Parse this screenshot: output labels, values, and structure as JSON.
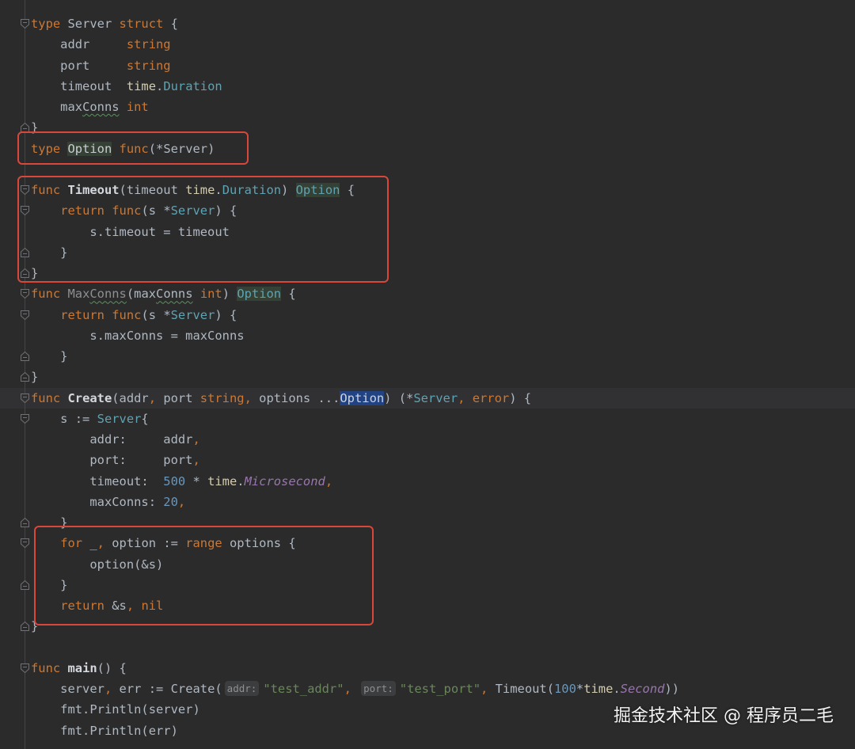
{
  "editor": {
    "lines": [
      {
        "fold_icon": "fold-start-icon",
        "tokens": [
          {
            "t": "type",
            "c": "#cc7832"
          },
          {
            "t": " Server ",
            "c": "#b0b8c1"
          },
          {
            "t": "struct",
            "c": "#cc7832"
          },
          {
            "t": " {",
            "c": "#b0b8c1"
          }
        ]
      },
      {
        "tokens": [
          {
            "t": "    addr     ",
            "c": "#b0b8c1"
          },
          {
            "t": "string",
            "c": "#cc7832"
          }
        ]
      },
      {
        "tokens": [
          {
            "t": "    port     ",
            "c": "#b0b8c1"
          },
          {
            "t": "string",
            "c": "#cc7832"
          }
        ]
      },
      {
        "tokens": [
          {
            "t": "    timeout  ",
            "c": "#b0b8c1"
          },
          {
            "t": "time",
            "c": "#d3ccae"
          },
          {
            "t": ".",
            "c": "#b0b8c1"
          },
          {
            "t": "Duration",
            "c": "#5fa3b3"
          }
        ]
      },
      {
        "tokens": [
          {
            "t": "    max",
            "c": "#b0b8c1"
          },
          {
            "t": "Conns",
            "c": "#b0b8c1",
            "wavy": true
          },
          {
            "t": " ",
            "c": "#b0b8c1"
          },
          {
            "t": "int",
            "c": "#cc7832"
          }
        ]
      },
      {
        "fold_icon": "fold-end-icon",
        "tokens": [
          {
            "t": "}",
            "c": "#b0b8c1"
          }
        ]
      },
      {
        "tokens": [
          {
            "t": "type",
            "c": "#cc7832"
          },
          {
            "t": " ",
            "c": "#b0b8c1"
          },
          {
            "t": "Option",
            "c": "#c9ccd1",
            "bg": "#344134"
          },
          {
            "t": " ",
            "c": "#b0b8c1"
          },
          {
            "t": "func",
            "c": "#cc7832"
          },
          {
            "t": "(*Server)",
            "c": "#b0b8c1"
          }
        ]
      },
      {
        "tokens": []
      },
      {
        "fold_icon": "fold-start-icon",
        "tokens": [
          {
            "t": "func",
            "c": "#cc7832"
          },
          {
            "t": " ",
            "c": "#b0b8c1"
          },
          {
            "t": "Timeout",
            "c": "#d4d7dc",
            "bold": true
          },
          {
            "t": "(timeout ",
            "c": "#b0b8c1"
          },
          {
            "t": "time",
            "c": "#d3ccae"
          },
          {
            "t": ".",
            "c": "#b0b8c1"
          },
          {
            "t": "Duration",
            "c": "#5fa3b3"
          },
          {
            "t": ") ",
            "c": "#b0b8c1"
          },
          {
            "t": "Option",
            "c": "#5fa3b3",
            "bg": "#344134"
          },
          {
            "t": " {",
            "c": "#b0b8c1"
          }
        ]
      },
      {
        "fold_icon": "fold-start-icon",
        "tokens": [
          {
            "t": "    ",
            "c": "#b0b8c1"
          },
          {
            "t": "return",
            "c": "#cc7832"
          },
          {
            "t": " ",
            "c": "#b0b8c1"
          },
          {
            "t": "func",
            "c": "#cc7832"
          },
          {
            "t": "(s *",
            "c": "#b0b8c1"
          },
          {
            "t": "Server",
            "c": "#5fa3b3"
          },
          {
            "t": ") {",
            "c": "#b0b8c1"
          }
        ]
      },
      {
        "tokens": [
          {
            "t": "        s.timeout = timeout",
            "c": "#b0b8c1"
          }
        ]
      },
      {
        "fold_icon": "fold-end-icon",
        "tokens": [
          {
            "t": "    }",
            "c": "#b0b8c1"
          }
        ]
      },
      {
        "fold_icon": "fold-end-icon",
        "tokens": [
          {
            "t": "}",
            "c": "#b0b8c1"
          }
        ]
      },
      {
        "fold_icon": "fold-start-icon",
        "tokens": [
          {
            "t": "func",
            "c": "#cc7832"
          },
          {
            "t": " ",
            "c": "#b0b8c1"
          },
          {
            "t": "Max",
            "c": "#8e8f91"
          },
          {
            "t": "Conns",
            "c": "#8e8f91",
            "wavy": true
          },
          {
            "t": "(max",
            "c": "#b0b8c1"
          },
          {
            "t": "Conns",
            "c": "#b0b8c1",
            "wavy": true
          },
          {
            "t": " ",
            "c": "#b0b8c1"
          },
          {
            "t": "int",
            "c": "#cc7832"
          },
          {
            "t": ") ",
            "c": "#b0b8c1"
          },
          {
            "t": "Option",
            "c": "#5fa3b3",
            "bg": "#344134"
          },
          {
            "t": " {",
            "c": "#b0b8c1"
          }
        ]
      },
      {
        "fold_icon": "fold-start-icon",
        "tokens": [
          {
            "t": "    ",
            "c": "#b0b8c1"
          },
          {
            "t": "return",
            "c": "#cc7832"
          },
          {
            "t": " ",
            "c": "#b0b8c1"
          },
          {
            "t": "func",
            "c": "#cc7832"
          },
          {
            "t": "(s *",
            "c": "#b0b8c1"
          },
          {
            "t": "Server",
            "c": "#5fa3b3"
          },
          {
            "t": ") {",
            "c": "#b0b8c1"
          }
        ]
      },
      {
        "tokens": [
          {
            "t": "        s.maxConns = maxConns",
            "c": "#b0b8c1"
          }
        ]
      },
      {
        "fold_icon": "fold-end-icon",
        "tokens": [
          {
            "t": "    }",
            "c": "#b0b8c1"
          }
        ]
      },
      {
        "fold_icon": "fold-end-icon",
        "tokens": [
          {
            "t": "}",
            "c": "#b0b8c1"
          }
        ]
      },
      {
        "fold_icon": "fold-start-icon",
        "current": true,
        "tokens": [
          {
            "t": "func",
            "c": "#cc7832"
          },
          {
            "t": " ",
            "c": "#b0b8c1"
          },
          {
            "t": "Create",
            "c": "#d4d7dc",
            "bold": true
          },
          {
            "t": "(addr",
            "c": "#b0b8c1"
          },
          {
            "t": ",",
            "c": "#cc7832"
          },
          {
            "t": " port ",
            "c": "#b0b8c1"
          },
          {
            "t": "string",
            "c": "#cc7832"
          },
          {
            "t": ",",
            "c": "#cc7832"
          },
          {
            "t": " options ...",
            "c": "#b0b8c1"
          },
          {
            "t": "Option",
            "c": "#c9d3e3",
            "bg": "#214283"
          },
          {
            "t": ") (*",
            "c": "#b0b8c1"
          },
          {
            "t": "Server",
            "c": "#5fa3b3"
          },
          {
            "t": ",",
            "c": "#cc7832"
          },
          {
            "t": " ",
            "c": "#b0b8c1"
          },
          {
            "t": "error",
            "c": "#cc7832"
          },
          {
            "t": ") {",
            "c": "#b0b8c1"
          }
        ]
      },
      {
        "fold_icon": "fold-start-icon",
        "tokens": [
          {
            "t": "    s := ",
            "c": "#b0b8c1"
          },
          {
            "t": "Server",
            "c": "#5fa3b3"
          },
          {
            "t": "{",
            "c": "#b0b8c1"
          }
        ]
      },
      {
        "tokens": [
          {
            "t": "        addr:     addr",
            "c": "#b0b8c1"
          },
          {
            "t": ",",
            "c": "#cc7832"
          }
        ]
      },
      {
        "tokens": [
          {
            "t": "        port:     port",
            "c": "#b0b8c1"
          },
          {
            "t": ",",
            "c": "#cc7832"
          }
        ]
      },
      {
        "tokens": [
          {
            "t": "        timeout:  ",
            "c": "#b0b8c1"
          },
          {
            "t": "500",
            "c": "#6897bb"
          },
          {
            "t": " * ",
            "c": "#b0b8c1"
          },
          {
            "t": "time",
            "c": "#d3ccae"
          },
          {
            "t": ".",
            "c": "#b0b8c1"
          },
          {
            "t": "Microsecond",
            "c": "#9876aa",
            "italic": true
          },
          {
            "t": ",",
            "c": "#cc7832"
          }
        ]
      },
      {
        "tokens": [
          {
            "t": "        maxConns: ",
            "c": "#b0b8c1"
          },
          {
            "t": "20",
            "c": "#6897bb"
          },
          {
            "t": ",",
            "c": "#cc7832"
          }
        ]
      },
      {
        "fold_icon": "fold-end-icon",
        "tokens": [
          {
            "t": "    }",
            "c": "#b0b8c1"
          }
        ]
      },
      {
        "fold_icon": "fold-start-icon",
        "tokens": [
          {
            "t": "    ",
            "c": "#b0b8c1"
          },
          {
            "t": "for",
            "c": "#cc7832"
          },
          {
            "t": " _",
            "c": "#b0b8c1"
          },
          {
            "t": ",",
            "c": "#cc7832"
          },
          {
            "t": " option := ",
            "c": "#b0b8c1"
          },
          {
            "t": "range",
            "c": "#cc7832"
          },
          {
            "t": " options {",
            "c": "#b0b8c1"
          }
        ]
      },
      {
        "tokens": [
          {
            "t": "        option(&s)",
            "c": "#b0b8c1"
          }
        ]
      },
      {
        "fold_icon": "fold-end-icon",
        "tokens": [
          {
            "t": "    }",
            "c": "#b0b8c1"
          }
        ]
      },
      {
        "tokens": [
          {
            "t": "    ",
            "c": "#b0b8c1"
          },
          {
            "t": "return",
            "c": "#cc7832"
          },
          {
            "t": " &s",
            "c": "#b0b8c1"
          },
          {
            "t": ",",
            "c": "#cc7832"
          },
          {
            "t": " ",
            "c": "#b0b8c1"
          },
          {
            "t": "nil",
            "c": "#cc7832"
          }
        ]
      },
      {
        "fold_icon": "fold-end-icon",
        "tokens": [
          {
            "t": "}",
            "c": "#b0b8c1"
          }
        ]
      },
      {
        "tokens": []
      },
      {
        "fold_icon": "fold-start-icon",
        "tokens": [
          {
            "t": "func",
            "c": "#cc7832"
          },
          {
            "t": " ",
            "c": "#b0b8c1"
          },
          {
            "t": "main",
            "c": "#d4d7dc",
            "bold": true
          },
          {
            "t": "() {",
            "c": "#b0b8c1"
          }
        ]
      },
      {
        "tokens": [
          {
            "t": "    server",
            "c": "#b0b8c1"
          },
          {
            "t": ",",
            "c": "#cc7832"
          },
          {
            "t": " err := Create(",
            "c": "#b0b8c1"
          },
          {
            "t": "addr:",
            "hint": true
          },
          {
            "t": "\"test_addr\"",
            "c": "#6a8759"
          },
          {
            "t": ",",
            "c": "#cc7832"
          },
          {
            "t": " ",
            "c": "#b0b8c1"
          },
          {
            "t": "port:",
            "hint": true
          },
          {
            "t": "\"test_port\"",
            "c": "#6a8759"
          },
          {
            "t": ",",
            "c": "#cc7832"
          },
          {
            "t": " Timeout(",
            "c": "#b0b8c1"
          },
          {
            "t": "100",
            "c": "#6897bb"
          },
          {
            "t": "*",
            "c": "#b0b8c1"
          },
          {
            "t": "time",
            "c": "#d3ccae"
          },
          {
            "t": ".",
            "c": "#b0b8c1"
          },
          {
            "t": "Second",
            "c": "#9876aa",
            "italic": true
          },
          {
            "t": "))",
            "c": "#b0b8c1"
          }
        ]
      },
      {
        "tokens": [
          {
            "t": "    fmt.Println(server)",
            "c": "#b0b8c1"
          }
        ]
      },
      {
        "tokens": [
          {
            "t": "    fmt.Println(err)",
            "c": "#b0b8c1"
          }
        ]
      }
    ]
  },
  "watermark": "掘金技术社区 @ 程序员二毛"
}
